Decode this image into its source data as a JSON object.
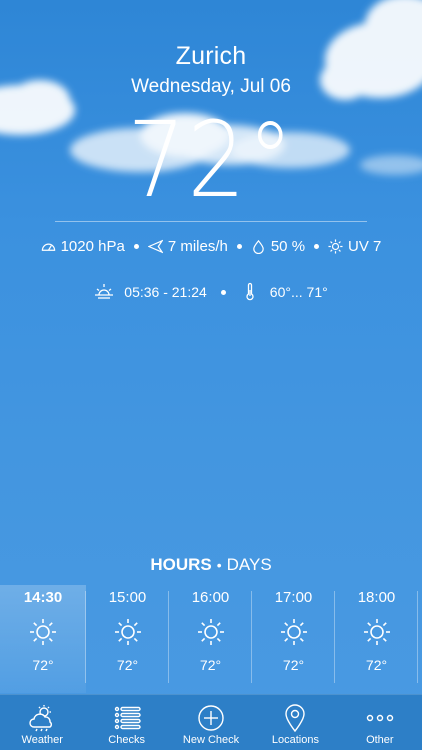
{
  "header": {
    "city": "Zurich",
    "date": "Wednesday, Jul 06",
    "temperature": "72°"
  },
  "stats": {
    "pressure": "1020 hPa",
    "wind": "7 miles/h",
    "humidity": "50 %",
    "uv": "UV 7"
  },
  "sun": {
    "times": "05:36 - 21:24",
    "range": "60°... 71°"
  },
  "forecast_switch": {
    "active": "HOURS",
    "separator": "•",
    "inactive": "DAYS"
  },
  "hours": [
    {
      "time": "14:30",
      "temp": "72°",
      "icon": "sun-icon"
    },
    {
      "time": "15:00",
      "temp": "72°",
      "icon": "sun-icon"
    },
    {
      "time": "16:00",
      "temp": "72°",
      "icon": "sun-icon"
    },
    {
      "time": "17:00",
      "temp": "72°",
      "icon": "sun-icon"
    },
    {
      "time": "18:00",
      "temp": "72°",
      "icon": "sun-icon"
    }
  ],
  "tabbar": {
    "items": [
      {
        "label": "Weather",
        "icon": "cloud-sun-icon"
      },
      {
        "label": "Checks",
        "icon": "list-icon"
      },
      {
        "label": "New Check",
        "icon": "plus-circle-icon"
      },
      {
        "label": "Locations",
        "icon": "location-pin-icon"
      },
      {
        "label": "Other",
        "icon": "more-icon"
      }
    ]
  },
  "colors": {
    "background": "#3b91df",
    "tabbar": "#2d7fc7",
    "text": "#ffffff"
  }
}
